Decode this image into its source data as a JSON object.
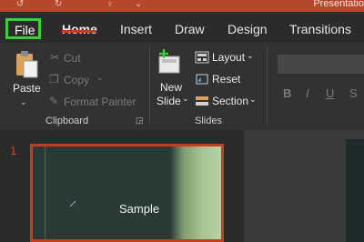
{
  "window": {
    "title": "Presentatio"
  },
  "tabs": [
    "File",
    "Home",
    "Insert",
    "Draw",
    "Design",
    "Transitions"
  ],
  "clipboard": {
    "paste": "Paste",
    "cut": "Cut",
    "copy": "Copy",
    "format_painter": "Format Painter",
    "group": "Clipboard"
  },
  "slides_group": {
    "new_slide_line1": "New",
    "new_slide_line2": "Slide",
    "layout": "Layout",
    "reset": "Reset",
    "section": "Section",
    "group": "Slides"
  },
  "font": {
    "bold": "B",
    "italic": "I",
    "underline": "U",
    "strike": "S"
  },
  "thumbnail": {
    "number": "1",
    "text": "Sample"
  },
  "colors": {
    "accent": "#c43e1c",
    "highlight": "#3bd13b",
    "titlebar": "#b7472a"
  }
}
